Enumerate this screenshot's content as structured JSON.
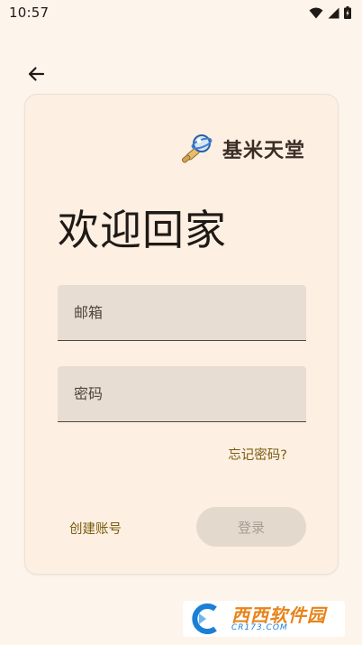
{
  "status_bar": {
    "time": "10:57"
  },
  "header": {
    "back_icon": "arrow-left-icon"
  },
  "brand": {
    "logo_icon": "jimi-logo-icon",
    "name": "基米天堂"
  },
  "login": {
    "title": "欢迎回家",
    "email_placeholder": "邮箱",
    "password_placeholder": "密码",
    "forgot_label": "忘记密码?",
    "create_label": "创建账号",
    "login_label": "登录"
  },
  "watermark": {
    "text": "西西软件园",
    "url": "CR173.COM"
  },
  "colors": {
    "background": "#fdf4ec",
    "card": "#fdefe2",
    "field": "#e8ddd2",
    "accent": "#7a5c10",
    "button_disabled": "#e4d9cd"
  }
}
